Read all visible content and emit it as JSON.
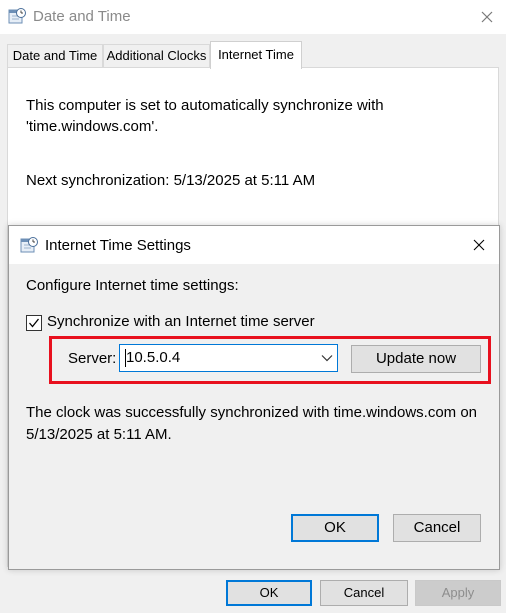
{
  "window": {
    "title": "Date and Time",
    "tabs": [
      {
        "label": "Date and Time"
      },
      {
        "label": "Additional Clocks"
      },
      {
        "label": "Internet Time"
      }
    ],
    "active_tab": "Internet Time",
    "panel": {
      "sync_line1": "This computer is set to automatically synchronize with",
      "sync_line2": "'time.windows.com'.",
      "next_sync": "Next synchronization: 5/13/2025 at 5:11 AM"
    },
    "buttons": {
      "ok": "OK",
      "cancel": "Cancel",
      "apply": "Apply"
    }
  },
  "dialog": {
    "title": "Internet Time Settings",
    "heading": "Configure Internet time settings:",
    "sync_checkbox_label": "Synchronize with an Internet time server",
    "sync_checked": true,
    "server_label": "Server:",
    "server_value": "10.5.0.4",
    "update_button": "Update now",
    "status_line1": "The clock was successfully synchronized with time.windows.com on",
    "status_line2": "5/13/2025 at 5:11 AM.",
    "buttons": {
      "ok": "OK",
      "cancel": "Cancel"
    }
  },
  "colors": {
    "highlight_border": "#e8101e",
    "focus_accent": "#0078d7"
  },
  "icons": {
    "window_icon": "clock-calendar-icon",
    "close_icon": "close-icon",
    "dropdown_icon": "chevron-down-icon"
  }
}
